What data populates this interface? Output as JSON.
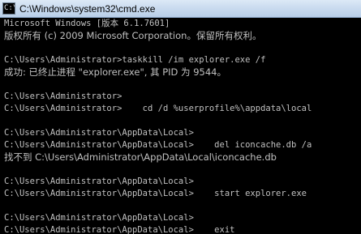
{
  "window": {
    "title": "C:\\Windows\\system32\\cmd.exe",
    "icon_glyph": "C:\\"
  },
  "console": {
    "lines": [
      "Microsoft Windows [版本 6.1.7601]",
      "版权所有 (c) 2009 Microsoft Corporation。保留所有权利。",
      "",
      "C:\\Users\\Administrator>taskkill /im explorer.exe /f",
      "成功: 已终止进程 \"explorer.exe\", 其 PID 为 9544。",
      "",
      "C:\\Users\\Administrator>",
      "C:\\Users\\Administrator>    cd /d %userprofile%\\appdata\\local",
      "",
      "C:\\Users\\Administrator\\AppData\\Local>",
      "C:\\Users\\Administrator\\AppData\\Local>    del iconcache.db /a",
      "找不到 C:\\Users\\Administrator\\AppData\\Local\\iconcache.db",
      "",
      "C:\\Users\\Administrator\\AppData\\Local>",
      "C:\\Users\\Administrator\\AppData\\Local>    start explorer.exe",
      "",
      "C:\\Users\\Administrator\\AppData\\Local>",
      "C:\\Users\\Administrator\\AppData\\Local>    exit"
    ]
  },
  "colors": {
    "console_bg": "#000000",
    "console_text": "#c0c0c0",
    "titlebar": "#c7d9ee"
  },
  "icons": {
    "window_icon": "cmd-icon"
  }
}
